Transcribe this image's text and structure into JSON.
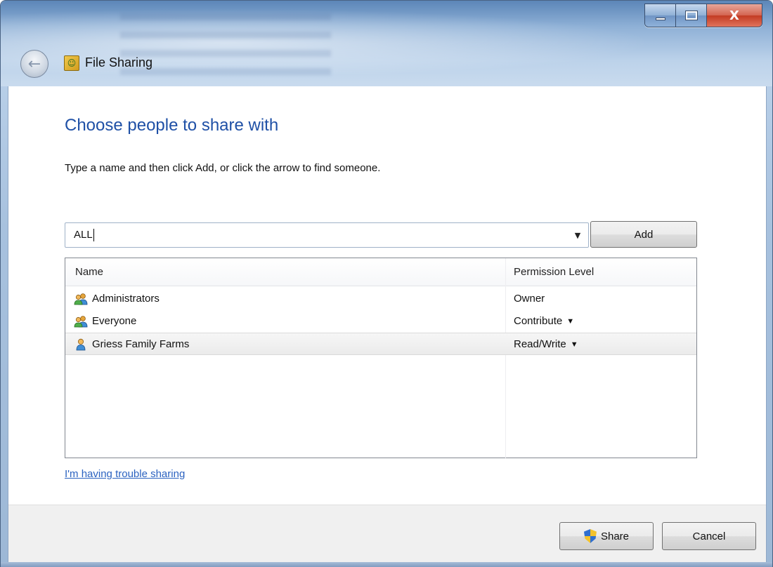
{
  "window": {
    "title": "File Sharing",
    "icon": "file-sharing-icon"
  },
  "caption": {
    "minimize_icon": "minimize-icon",
    "maximize_icon": "maximize-icon",
    "close_label": "X"
  },
  "content": {
    "heading": "Choose people to share with",
    "instruction": "Type a name and then click Add, or click the arrow to find someone."
  },
  "combo": {
    "value": "ALL",
    "arrow": "▼"
  },
  "buttons": {
    "add": "Add",
    "share": "Share",
    "cancel": "Cancel"
  },
  "list": {
    "columns": {
      "name": "Name",
      "permission": "Permission Level"
    },
    "rows": [
      {
        "name": "Administrators",
        "permission": "Owner",
        "has_dropdown": false,
        "icon": "group-icon",
        "selected": false
      },
      {
        "name": "Everyone",
        "permission": "Contribute",
        "has_dropdown": true,
        "icon": "group-icon",
        "selected": false
      },
      {
        "name": "Griess Family Farms",
        "permission": "Read/Write",
        "has_dropdown": true,
        "icon": "user-icon",
        "selected": true
      }
    ],
    "dropdown_arrow": "▼"
  },
  "help_link": "I'm having trouble sharing",
  "colors": {
    "heading": "#1f50a6",
    "link": "#2b62c0",
    "close_button": "#c33b22"
  }
}
